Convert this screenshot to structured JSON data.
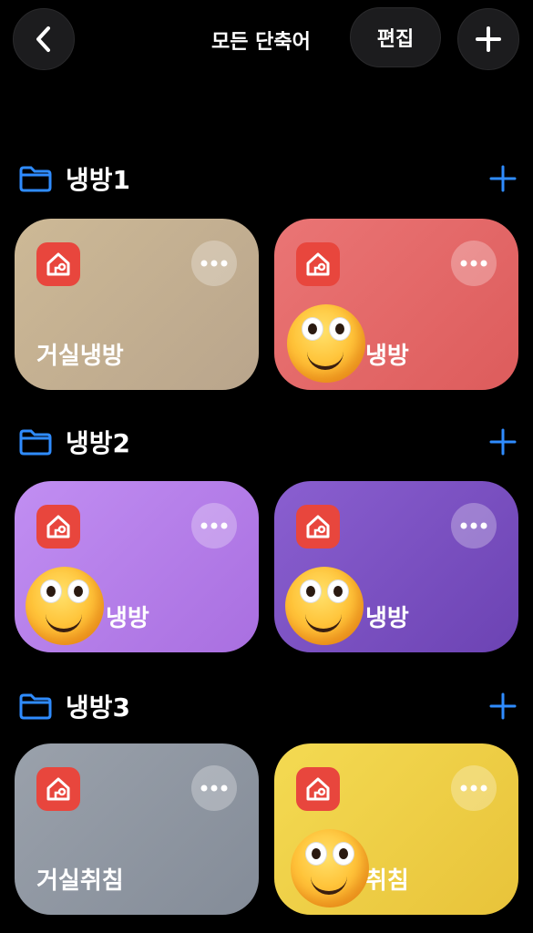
{
  "header": {
    "title": "모든 단축어",
    "edit_label": "편집"
  },
  "sections": [
    {
      "title": "냉방1",
      "cards": [
        {
          "label": "거실냉방",
          "color": "#c9b596"
        },
        {
          "label": "냉방",
          "color": "#e66d6d"
        }
      ]
    },
    {
      "title": "냉방2",
      "cards": [
        {
          "label": "냉방",
          "color": "#b57fe8"
        },
        {
          "label": "냉방",
          "color": "#7a52c2"
        }
      ]
    },
    {
      "title": "냉방3",
      "cards": [
        {
          "label": "거실취침",
          "color": "#8d95a1"
        },
        {
          "label": "취침",
          "color": "#f1d24a"
        }
      ]
    }
  ],
  "colors": {
    "accent": "#2f8cff",
    "app_icon": "#e8463d",
    "background": "#000000"
  },
  "icons": [
    "chevron-left-icon",
    "plus-icon",
    "folder-icon",
    "home-app-icon",
    "more-icon",
    "smiley-emoji-icon"
  ]
}
